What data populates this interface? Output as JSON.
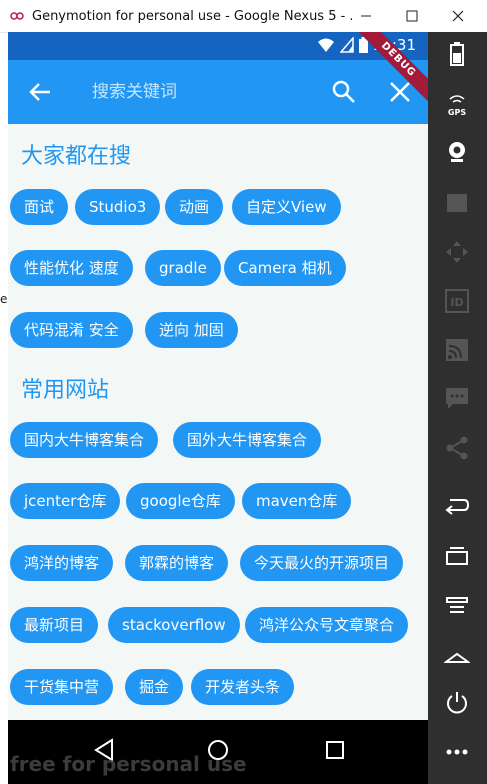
{
  "window": {
    "title": "Genymotion for personal use - Google Nexus 5 - ...",
    "colors": {
      "titlebar": "#ffffff"
    }
  },
  "status_bar": {
    "time": "11:31",
    "icons": [
      "wifi-icon",
      "signal-icon",
      "battery-icon"
    ]
  },
  "app_bar": {
    "search_placeholder": "搜索关键词",
    "icons": [
      "back-arrow-icon",
      "search-icon",
      "close-icon"
    ],
    "debug_ribbon": "DEBUG",
    "color": "#2196f3"
  },
  "sections": [
    {
      "title": "大家都在搜",
      "chips": [
        "面试",
        "Studio3",
        "动画",
        "自定义View",
        "性能优化 速度",
        "gradle",
        "Camera 相机",
        "代码混淆 安全",
        "逆向 加固"
      ]
    },
    {
      "title": "常用网站",
      "chips": [
        "国内大牛博客集合",
        "国外大牛博客集合",
        "jcenter仓库",
        "google仓库",
        "maven仓库",
        "鸿洋的博客",
        "郭霖的博客",
        "今天最火的开源项目",
        "最新项目",
        "stackoverflow",
        "鸿洋公众号文章聚合",
        "干货集中营",
        "掘金",
        "开发者头条"
      ]
    }
  ],
  "nav_bar": {
    "icons": [
      "back-triangle-icon",
      "home-circle-icon",
      "recents-square-icon"
    ]
  },
  "watermark": "free for personal use",
  "sidebar": {
    "icons": [
      "battery-icon",
      "gps-icon",
      "webcam-icon",
      "video-icon",
      "dpad-icon",
      "id-icon",
      "cast-icon",
      "sms-icon",
      "share-icon",
      "back-icon",
      "recent-apps-icon",
      "menu-icon",
      "home-icon",
      "power-icon",
      "more-icon"
    ],
    "labels": {
      "gps": "GPS",
      "id": "ID"
    }
  },
  "left_edge_fragment": "e"
}
